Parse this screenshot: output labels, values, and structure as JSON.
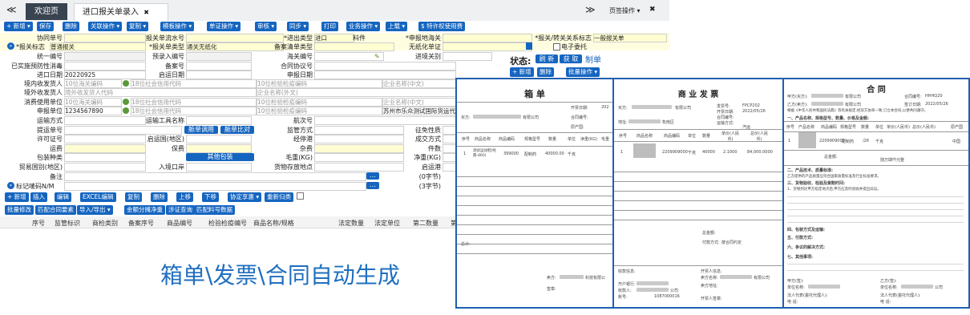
{
  "tabs": {
    "home": "欢迎页",
    "active": "进口报关单录入",
    "close": "✖",
    "nav_prev": "≪",
    "nav_next": "≫",
    "page_ops": "页签操作",
    "page_ops_arrow": "▾",
    "expand": "✖"
  },
  "toolbar": [
    "+ 新增 ▾",
    "保存",
    "删除",
    "关联操作 ▾",
    "复制 ▾",
    "模板操作 ▾",
    "单证操作 ▾",
    "审核 ▾",
    "同步 ▾",
    "打印",
    "业务操作 ▾",
    "上载 ▾",
    "$ 特许权使用费"
  ],
  "form": {
    "r1": {
      "l1": "协同单号",
      "l2": "报关单流水号",
      "l3": "*进出类型",
      "v3": "进口",
      "l3b": "料件",
      "l4": "*申报地海关",
      "l5": "*报关/转关关系标志",
      "v5": "一般报关单"
    },
    "r2": {
      "l1": "*报关标志",
      "v1": "普通报关",
      "l2": "*报关单类型",
      "v2": "通关无纸化",
      "l3": "备案清单类型",
      "l4": "无纸化单证",
      "l5": "电子委托"
    },
    "r3": {
      "l1": "统一编号",
      "l2": "预录入编号",
      "l3": "海关编号",
      "l4": "进境关别"
    },
    "r4": {
      "l1": "已实施预防性消毒",
      "l2": "备案号",
      "l3": "合同协议号"
    },
    "r5": {
      "l1": "进口日期",
      "v1": "20220925",
      "l2": "启运日期",
      "l3": "申报日期"
    },
    "r6": {
      "l1": "境内收发货人",
      "p1": "10位海关编码",
      "p2": "18位社会信用代码",
      "p3": "10位检验检疫编码",
      "p4": "企业名称(中文)"
    },
    "r7": {
      "l1": "境外收发货人",
      "p1": "境外收发货人代码",
      "p2": "企业名称(外文)"
    },
    "r8": {
      "l1": "消费使用单位",
      "p1": "10位海关编码",
      "p2": "18位社会信用代码",
      "p3": "10位检验检疫编码",
      "p4": "企业名称(中文)"
    },
    "r9": {
      "l1": "申报单位",
      "v1": "1234567890",
      "p2": "18位社会信用代码",
      "p3": "10位检验检疫编码",
      "v4": "苏州市乐众测试国际货运代理"
    },
    "r10": {
      "l1": "运输方式",
      "l2": "运输工具名称",
      "l3": "航次号"
    },
    "r11": {
      "l1": "提运单号",
      "b1": "舱单调用",
      "b2": "舱单比对",
      "l3": "监管方式",
      "l4": "征免性质"
    },
    "r12": {
      "l1": "许可证号",
      "l2": "启运国(地区)",
      "l3": "经停港",
      "l4": "成交方式"
    },
    "r13": {
      "l1": "运费",
      "l2": "保费",
      "l3": "杂费",
      "l4": "件数"
    },
    "r14": {
      "l1": "包装种类",
      "b1": "其他包装",
      "l3": "毛重(KG)",
      "l4": "净重(KG)"
    },
    "r15": {
      "l1": "贸易国别(地区)",
      "l2": "入境口岸",
      "l3": "货物存放地点",
      "l4": "启运港"
    },
    "r16": {
      "l1": "备注",
      "b": "...",
      "c": "(0字节)"
    },
    "r17": {
      "l1": "标记唛码N/M",
      "b": "...",
      "c": "(3字节)"
    }
  },
  "list_toolbar1": [
    "+ 新增",
    "插入",
    "编辑",
    "EXCEL编辑",
    "复制",
    "删除",
    "上移",
    "下移",
    "协定享惠 ▾",
    "重新归类"
  ],
  "list_toolbar2": [
    "批量修改",
    "匹配合同要素",
    "导入/导出 ▾",
    "金额分摊净重",
    "涉证查询",
    "匹配料号数据"
  ],
  "list_headers": [
    "序号",
    "监管标识",
    "商检类别",
    "备案序号",
    "商品编号",
    "检验检疫编号",
    "商品名称/规格",
    "法定数量",
    "法定单位",
    "第二数量",
    "第"
  ],
  "status": {
    "label": "状态:",
    "b1": "刷 新",
    "b2": "获 取",
    "b3": "制单"
  },
  "status_toolbar": [
    "+ 新增",
    "删除",
    "批量操作 ▾"
  ],
  "caption": "箱单\\发票\\合同自动生成",
  "docs": {
    "packing": {
      "title": "箱 单",
      "buyer_label": "买方:",
      "buyer_suffix": "有限公司",
      "date_label": "开票日期:",
      "date_prefix": "202",
      "contract_label": "合同编号:",
      "origin_label": "原产国:",
      "headers": [
        "序号",
        "商品名称",
        "商品编码",
        "规格型号",
        "数量",
        "单位",
        "净重(KG)",
        "毛重"
      ],
      "row": [
        "1",
        "测试运动鞋(经典-860)",
        "399000",
        "配制药",
        "40000.00",
        "千克"
      ],
      "total_label": "总计:",
      "seller_label": "卖方:",
      "seller_suffix": "科技有限公",
      "sign_label": "签章:"
    },
    "invoice": {
      "title": "商 业 发 票",
      "buyer_label": "买方:",
      "buyer_suffix": "有限公司",
      "invno_label": "发票号:",
      "invno": "FPCP202",
      "date_label": "开票日期:",
      "date": "2022/05/26",
      "contract_label": "合同编号:",
      "addr_label": "地址:",
      "addr_suffix": "牧南区",
      "transport_label": "运输方式:",
      "transport": "汽运",
      "headers": [
        "序号",
        "商品名称",
        "商品编码",
        "单位",
        "数量",
        "单价(人民币)",
        "总价(人民币)"
      ],
      "row": [
        "1",
        "",
        "2209909000",
        "千克",
        "40000",
        "2.1000",
        "84,000.0000"
      ],
      "total_label": "总金额:",
      "pay_label": "付款方式:",
      "pay": "按合同约定",
      "bank_label": "收款信息:",
      "bank1": "开户银行:",
      "bank2": "收款人:",
      "bank3": "账号:",
      "bank3v": "1087000016",
      "company_suffix": "公司",
      "open_label": "开票人信息:",
      "seller_label": "卖方名称:",
      "seller_suffix": "有限公司",
      "seller_addr": "卖方地址:",
      "drawer_sign": "开票人签章:"
    },
    "contract": {
      "title": "合 同",
      "party_a": "甲方(买方):",
      "party_a_suffix": "有限公司",
      "contract_no_label": "合同编号:",
      "contract_no": "HHHQ20",
      "party_b": "乙方(卖方):",
      "party_b_suffix": "有限公司",
      "sign_date_label": "签订日期:",
      "sign_date": "2022/05/26",
      "intro": "根据《中华人民共和国民法典》等有关规定,经双方协商一致,订立本合同,以便共同遵守。",
      "sec1": "一、产品名称、规格型号、数量、价格及金额:",
      "headers": [
        "序号",
        "产品名称",
        "商品编码",
        "规格型号",
        "数量",
        "单位",
        "单价(人民币)",
        "总价(人民币)",
        "原产国"
      ],
      "row": [
        "1",
        "",
        "2209909000",
        "配制药",
        "/26",
        "千克",
        "",
        "",
        "中国"
      ],
      "total_label": "总金额:",
      "total_words": "捌万肆仟元整",
      "sec2": "二、产品技术、质量标准:",
      "sec2_text": "乙方提供的产品质量应符合国家质量标准及行业标准要求。",
      "sec3": "三、货物验收、检验及索赔时间:",
      "sec3_text": "1、货物到达甲方指定地点后,甲方应及时验收并提出异议。",
      "sec4": "四、包装方式及运输:",
      "sec5": "五、付款方式:",
      "sec6": "六、争议的解决方式:",
      "sec7": "七、其他事项:",
      "sign_a": "甲方(签):",
      "sign_b": "乙方(签):",
      "unit_a": "单位名称:",
      "unit_b": "单位名称:",
      "unit_suffix": "公司",
      "agent_a": "法人代表(委托代理人):",
      "agent_b": "法人代表(委托代理人):",
      "phone_a": "电 话:",
      "phone_b": "电 话:"
    }
  }
}
